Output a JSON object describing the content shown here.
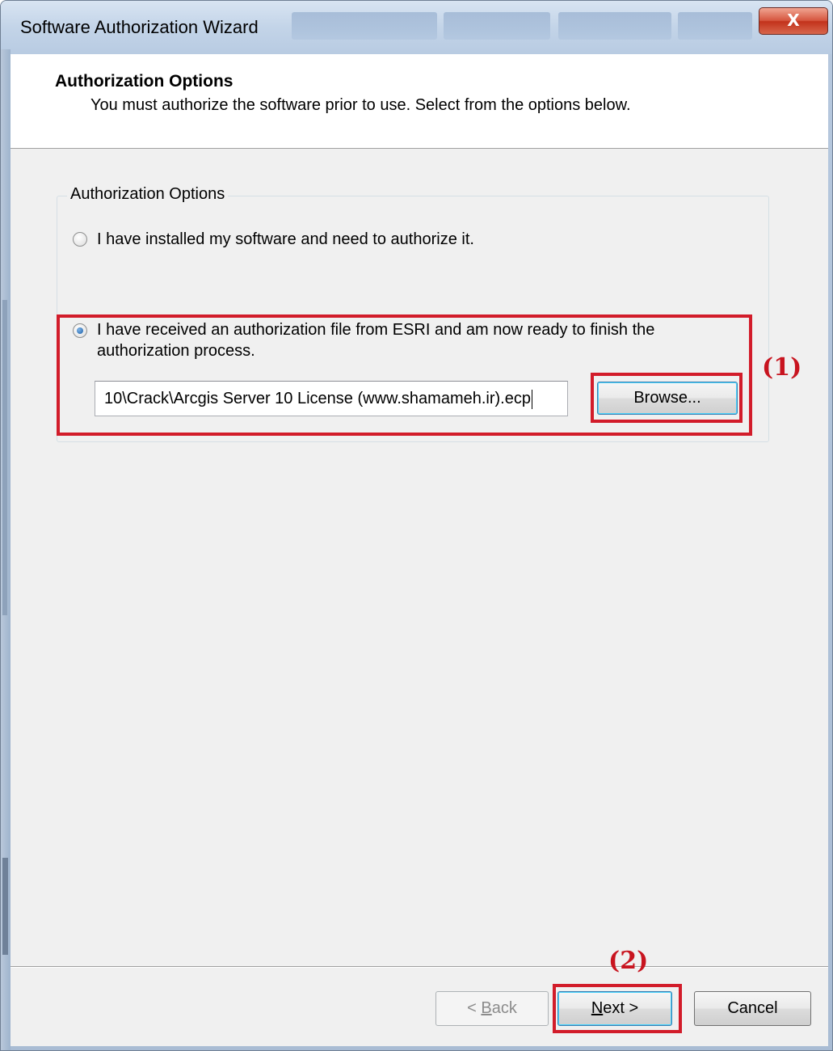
{
  "window": {
    "title": "Software Authorization Wizard",
    "close_glyph": "X"
  },
  "header": {
    "title": "Authorization Options",
    "subtitle": "You must authorize the software prior to use. Select from the options below."
  },
  "group": {
    "label": "Authorization Options",
    "options": [
      {
        "label": "I have installed my software and need to authorize it.",
        "selected": false
      },
      {
        "label_line1": "I have received an authorization file from ESRI and am now ready to finish the",
        "label_line2": "authorization process.",
        "selected": true
      }
    ],
    "file_path": "10\\Crack\\Arcgis Server 10 License (www.shamameh.ir).ecp",
    "browse_label": "Browse..."
  },
  "buttons": {
    "back": {
      "prefix": "< ",
      "mnemonic": "B",
      "rest": "ack",
      "enabled": false
    },
    "next": {
      "mnemonic": "N",
      "rest": "ext >",
      "enabled": true
    },
    "cancel": "Cancel"
  },
  "annotations": {
    "step1": "(1)",
    "step2": "(2)"
  },
  "colors": {
    "annotation_red": "#d21c2a",
    "dialog_face": "#f0f0f0",
    "selected_radio": "#1b5fa8"
  }
}
